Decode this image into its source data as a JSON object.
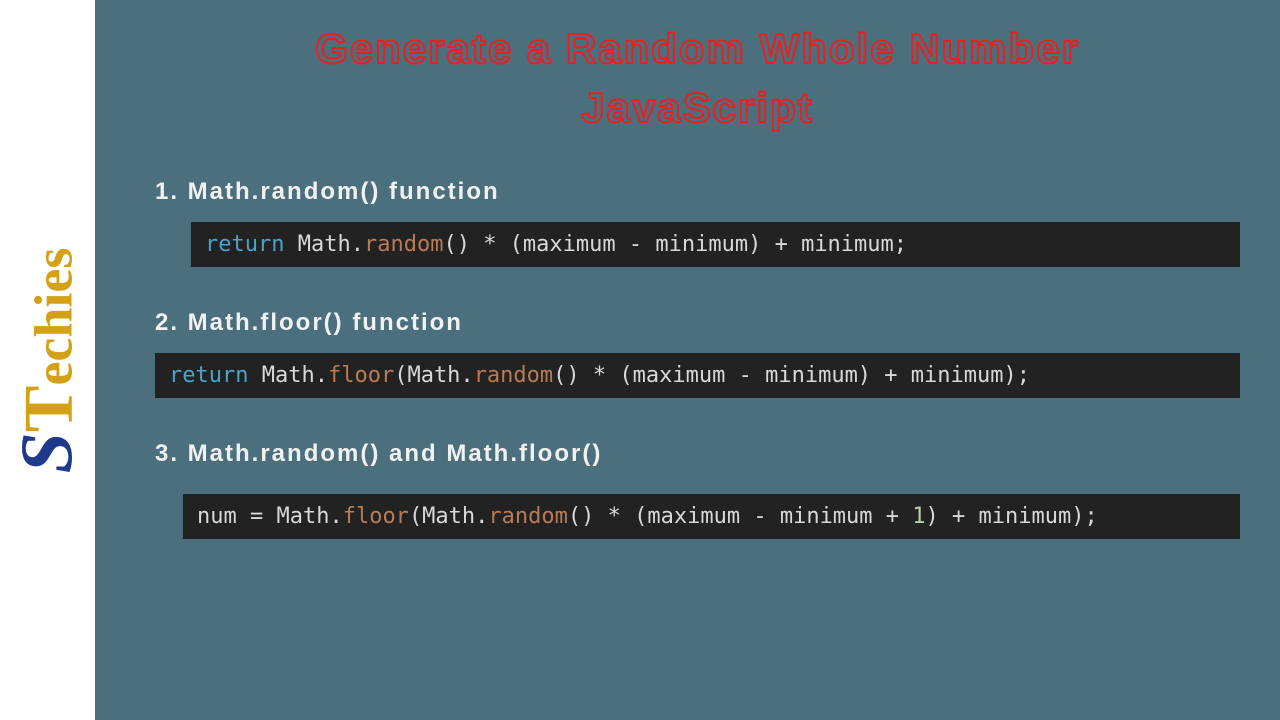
{
  "logo": {
    "s": "S",
    "t": "T",
    "rest": "echies"
  },
  "title": {
    "line1": "Generate a Random Whole Number",
    "line2": "JavaScript"
  },
  "sections": {
    "s1": {
      "heading": "1. Math.random() function",
      "code": {
        "t1": "return",
        "t2": " Math.",
        "t3": "random",
        "t4": "() * (maximum - minimum) + minimum;"
      }
    },
    "s2": {
      "heading": "2. Math.floor() function",
      "code": {
        "t1": "return",
        "t2": " Math.",
        "t3": "floor",
        "t4": "(Math.",
        "t5": "random",
        "t6": "() * (maximum - minimum) + minimum);"
      }
    },
    "s3": {
      "heading": "3. Math.random() and Math.floor()",
      "code": {
        "t1": "num = Math.",
        "t2": "floor",
        "t3": "(Math.",
        "t4": "random",
        "t5": "() * (maximum - minimum + ",
        "t6": "1",
        "t7": ") + minimum);"
      }
    }
  }
}
